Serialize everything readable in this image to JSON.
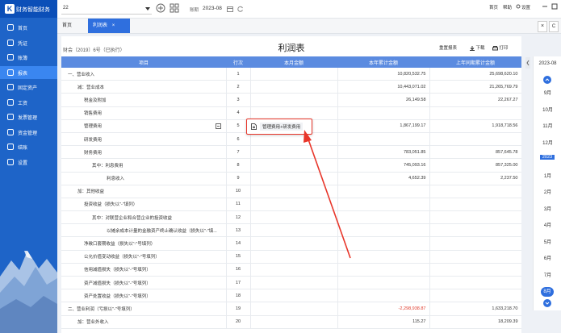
{
  "app": {
    "name": "财务智能财务",
    "logo_glyph": "K"
  },
  "sidebar": {
    "items": [
      {
        "label": "首页",
        "icon": "home-icon"
      },
      {
        "label": "凭证",
        "icon": "voucher-icon"
      },
      {
        "label": "账簿",
        "icon": "ledger-icon"
      },
      {
        "label": "报表",
        "icon": "report-icon",
        "active": true
      },
      {
        "label": "固定资产",
        "icon": "asset-icon"
      },
      {
        "label": "工资",
        "icon": "salary-icon"
      },
      {
        "label": "发票管理",
        "icon": "invoice-icon"
      },
      {
        "label": "资金管理",
        "icon": "fund-icon"
      },
      {
        "label": "结账",
        "icon": "checkout-icon"
      },
      {
        "label": "设置",
        "icon": "settings-icon"
      }
    ]
  },
  "topbar": {
    "account_select": "22",
    "period_label": "账期",
    "period_value": "2023-08",
    "links": [
      "首页",
      "帮助",
      "设置"
    ]
  },
  "tabs": [
    {
      "label": "首页",
      "active": false
    },
    {
      "label": "利润表",
      "active": true,
      "close": "×"
    }
  ],
  "tabbar_icons": {
    "close_all": "×",
    "refresh": "C"
  },
  "report": {
    "title": "利润表",
    "subtitle": "财会〔2019〕6号（已执行）",
    "actions": {
      "reset": "重置报表",
      "download": "下载",
      "print": "打印"
    },
    "columns": {
      "item": "项目",
      "line": "行次",
      "month": "本月金额",
      "ytd": "本年累计金额",
      "last_ytd": "上年同期累计金额"
    },
    "rows": [
      {
        "name": "一、营业收入",
        "indent": 0,
        "line": "1",
        "month": "",
        "ytd": "10,820,532.75",
        "last_ytd": "25,698,620.10"
      },
      {
        "name": "减：营业成本",
        "indent": 1,
        "line": "2",
        "month": "",
        "ytd": "10,443,071.02",
        "last_ytd": "21,265,769.79"
      },
      {
        "name": "税金及附加",
        "indent": 2,
        "line": "3",
        "month": "",
        "ytd": "26,149.58",
        "last_ytd": "22,267.27"
      },
      {
        "name": "销售费用",
        "indent": 2,
        "line": "4",
        "month": "",
        "ytd": "",
        "last_ytd": ""
      },
      {
        "name": "管理费用",
        "indent": 2,
        "line": "5",
        "month": "",
        "ytd": "1,867,199.17",
        "last_ytd": "1,918,718.56",
        "has_edit": true
      },
      {
        "name": "研发费用",
        "indent": 2,
        "line": "6",
        "month": "",
        "ytd": "",
        "last_ytd": ""
      },
      {
        "name": "财务费用",
        "indent": 2,
        "line": "7",
        "month": "",
        "ytd": "783,051.85",
        "last_ytd": "857,645.78"
      },
      {
        "name": "其中：利息费用",
        "indent": 3,
        "line": "8",
        "month": "",
        "ytd": "745,093.16",
        "last_ytd": "857,325.00"
      },
      {
        "name": "利息收入",
        "indent": 4,
        "line": "9",
        "month": "",
        "ytd": "4,652.39",
        "last_ytd": "2,237.50"
      },
      {
        "name": "加：其他收益",
        "indent": 1,
        "line": "10",
        "month": "",
        "ytd": "",
        "last_ytd": ""
      },
      {
        "name": "投资收益（损失以\"-\"填列）",
        "indent": 2,
        "line": "11",
        "month": "",
        "ytd": "",
        "last_ytd": ""
      },
      {
        "name": "其中：对联营企业和合营企业的投资收益",
        "indent": 3,
        "line": "12",
        "month": "",
        "ytd": "",
        "last_ytd": ""
      },
      {
        "name": "以摊余成本计量的金融资产终止确认收益（损失以\"-\"填...",
        "indent": 4,
        "line": "13",
        "month": "",
        "ytd": "",
        "last_ytd": ""
      },
      {
        "name": "净敞口套期收益（损失以\"-\"号填列）",
        "indent": 2,
        "line": "14",
        "month": "",
        "ytd": "",
        "last_ytd": ""
      },
      {
        "name": "公允价值变动收益（损失以\"-\"号填列）",
        "indent": 2,
        "line": "15",
        "month": "",
        "ytd": "",
        "last_ytd": ""
      },
      {
        "name": "信用减值损失（损失以\"-\"号填列）",
        "indent": 2,
        "line": "16",
        "month": "",
        "ytd": "",
        "last_ytd": ""
      },
      {
        "name": "资产减值损失（损失以\"-\"号填列）",
        "indent": 2,
        "line": "17",
        "month": "",
        "ytd": "",
        "last_ytd": ""
      },
      {
        "name": "资产处置收益（损失以\"-\"号填列）",
        "indent": 2,
        "line": "18",
        "month": "",
        "ytd": "",
        "last_ytd": ""
      },
      {
        "name": "二、营业利润（亏损以\"-\"号填列）",
        "indent": 0,
        "line": "19",
        "month": "",
        "ytd": "-2,298,938.87",
        "last_ytd": "1,633,218.70",
        "ytd_negative": true
      },
      {
        "name": "加：营业外收入",
        "indent": 1,
        "line": "20",
        "month": "",
        "ytd": "115.27",
        "last_ytd": "18,209.39"
      }
    ]
  },
  "tooltip": {
    "text": "管理费用+研发费用",
    "icon": "document-icon"
  },
  "colors": {
    "sidebar": "#1e64c8",
    "brand_bar": "#0b4fb8",
    "table_header": "#5b8be0",
    "accent": "#2f6fde",
    "annotation": "#e8362a",
    "negative": "#e03a2b"
  },
  "period_panel": {
    "year": "2023-08",
    "months": [
      "9月",
      "10月",
      "11月",
      "12月",
      "2023",
      "1月",
      "2月",
      "3月",
      "4月",
      "5月",
      "6月",
      "7月",
      "8月"
    ],
    "current": "8月"
  }
}
